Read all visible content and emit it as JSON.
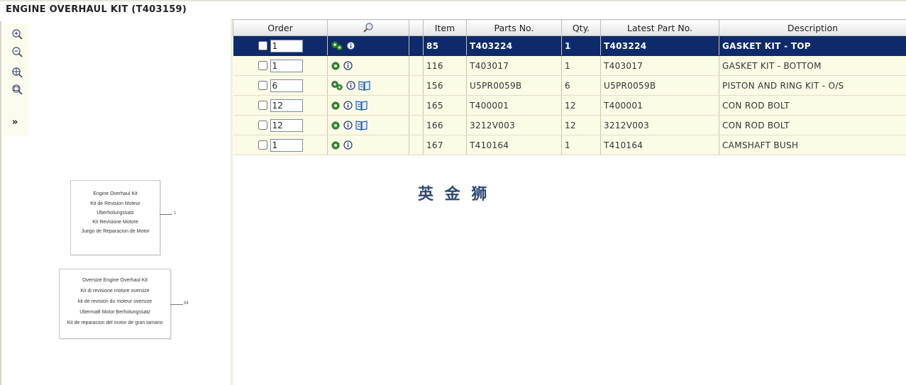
{
  "page": {
    "title": "ENGINE OVERHAUL KIT (T403159)"
  },
  "zoom_panel": {
    "buttons": [
      {
        "name": "zoom-in-icon"
      },
      {
        "name": "zoom-out-icon"
      },
      {
        "name": "zoom-fit-icon"
      },
      {
        "name": "zoom-window-icon"
      }
    ],
    "expand_label": "»"
  },
  "diagram": {
    "box1": {
      "lines": [
        "Engine Overhaul Kit",
        "Kit de Revision Moteur",
        "Uberholungssatz",
        "Kit Revisione Motore",
        "Juego de Reparacion de Motor"
      ],
      "callout": "1"
    },
    "box2": {
      "lines": [
        "Oversize Engine Overhaul Kit",
        "Kit di revisione motore oversize",
        "kit de revision du moteur oversize",
        "UbermaB Motor Berholungssatz",
        "Kit de reparacion del motor de gran tamano"
      ],
      "callout": "84"
    }
  },
  "table": {
    "headers": {
      "order": "Order",
      "search_icon": "search-icon",
      "item": "Item",
      "parts_no": "Parts No.",
      "qty": "Qty.",
      "latest": "Latest Part No.",
      "description": "Description"
    },
    "rows": [
      {
        "qty_input": "1",
        "icons": [
          "gears-icon",
          "info-icon"
        ],
        "item": "85",
        "parts_no": "T403224",
        "qty": "1",
        "latest": "T403224",
        "description": "GASKET KIT - TOP",
        "selected": true
      },
      {
        "qty_input": "1",
        "icons": [
          "gear-icon",
          "info-icon"
        ],
        "item": "116",
        "parts_no": "T403017",
        "qty": "1",
        "latest": "T403017",
        "description": "GASKET KIT - BOTTOM",
        "selected": false
      },
      {
        "qty_input": "6",
        "icons": [
          "gears-icon",
          "info-icon",
          "book-icon"
        ],
        "item": "156",
        "parts_no": "U5PR0059B",
        "qty": "6",
        "latest": "U5PR0059B",
        "description": "PISTON AND RING KIT - O/S",
        "selected": false
      },
      {
        "qty_input": "12",
        "icons": [
          "gear-icon",
          "info-icon",
          "book-icon"
        ],
        "item": "165",
        "parts_no": "T400001",
        "qty": "12",
        "latest": "T400001",
        "description": "CON ROD BOLT",
        "selected": false
      },
      {
        "qty_input": "12",
        "icons": [
          "gear-icon",
          "info-icon",
          "book-icon"
        ],
        "item": "166",
        "parts_no": "3212V003",
        "qty": "12",
        "latest": "3212V003",
        "description": "CON ROD BOLT",
        "selected": false
      },
      {
        "qty_input": "1",
        "icons": [
          "gear-icon",
          "info-icon"
        ],
        "item": "167",
        "parts_no": "T410164",
        "qty": "1",
        "latest": "T410164",
        "description": "CAMSHAFT BUSH",
        "selected": false
      }
    ]
  },
  "watermark": "英 金 狮",
  "colors": {
    "selected_row": "#0e2a6b",
    "row_bg": "#fbfbe6",
    "gear": "#2f8a2f",
    "info": "#2a3f7a",
    "book": "#1f5fb5"
  }
}
